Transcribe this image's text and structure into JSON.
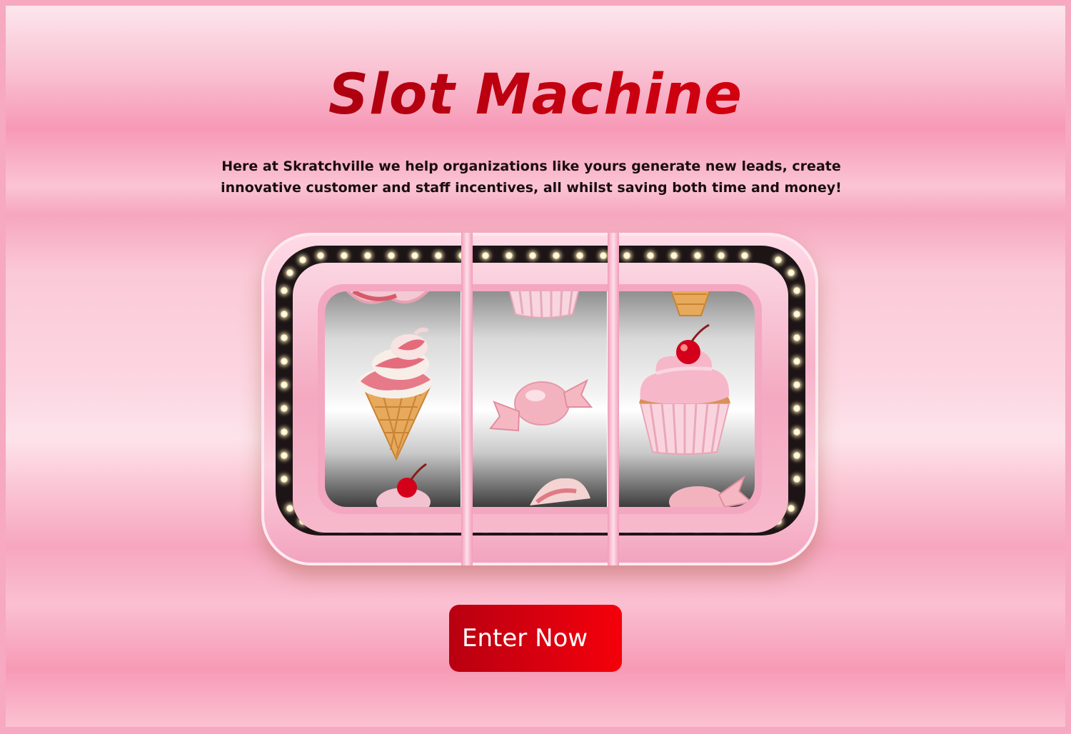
{
  "page": {
    "title": "Slot Machine",
    "intro": "Here at Skratchville we help organizations like yours generate new leads, create innovative customer and staff incentives, all whilst saving both time and money!",
    "cta_label": "Enter Now"
  },
  "reels": [
    {
      "top": "cupcake-icon",
      "center": "ice-cream-cone-icon",
      "bottom": "cupcake-icon"
    },
    {
      "top": "cupcake-icon",
      "center": "wrapped-candy-icon",
      "bottom": "ice-cream-cone-icon"
    },
    {
      "top": "ice-cream-cone-icon",
      "center": "cupcake-icon",
      "bottom": "wrapped-candy-icon"
    }
  ],
  "colors": {
    "title_dark": "#8e0010",
    "title_light": "#f2000d",
    "button": "#e0000d",
    "background": "#f6a9c0",
    "marquee": "#1d1416"
  }
}
